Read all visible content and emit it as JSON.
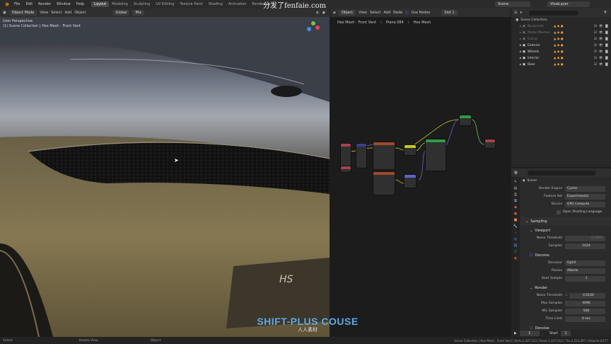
{
  "menu": [
    "File",
    "Edit",
    "Render",
    "Window",
    "Help"
  ],
  "workspaces": [
    "Layout",
    "Modeling",
    "Sculpting",
    "UV Editing",
    "Texture Paint",
    "Shading",
    "Animation",
    "Rendering"
  ],
  "active_workspace": "Layout",
  "topbar_right": {
    "watermark": "分发了fenfaie.com",
    "scene": "Scene",
    "viewlayer": "ViewLayer"
  },
  "viewport": {
    "mode": "Object Mode",
    "menus": [
      "View",
      "Select",
      "Add",
      "Object"
    ],
    "transform": "Global",
    "mix": "Mix",
    "title": "User Perspective",
    "subtitle": "(1) Scene Collection | Hex Mesh - Front Vent"
  },
  "node_editor": {
    "type": "Object",
    "menus": [
      "View",
      "Select",
      "Add",
      "Node"
    ],
    "use_nodes": "Use Nodes",
    "slot": "Slot 1",
    "breadcrumb": [
      "Hex Mesh - Front Vent",
      "Plane.084",
      "Hex Mesh"
    ]
  },
  "outliner": {
    "root": "Scene Collection",
    "items": [
      {
        "label": "Blueprints",
        "dim": true
      },
      {
        "label": "Model Meshes",
        "dim": true
      },
      {
        "label": "Extras",
        "dim": true
      },
      {
        "label": "Exterior",
        "dim": false
      },
      {
        "label": "Wheels",
        "dim": false
      },
      {
        "label": "Interior",
        "dim": false
      },
      {
        "label": "Door",
        "dim": false
      }
    ]
  },
  "properties": {
    "title": "Scene",
    "render_engine": {
      "label": "Render Engine",
      "value": "Cycles"
    },
    "feature_set": {
      "label": "Feature Set",
      "value": "Experimental"
    },
    "device": {
      "label": "Device",
      "value": "GPU Compute"
    },
    "osl": "Open Shading Language",
    "sampling": "Sampling",
    "viewport_section": "Viewport",
    "noise_threshold_vp": {
      "label": "Noise Threshold",
      "value": "0.1000"
    },
    "samples_vp": {
      "label": "Samples",
      "value": "1024"
    },
    "denoise": "Denoise",
    "denoiser": {
      "label": "Denoiser",
      "value": "OptiX"
    },
    "passes": {
      "label": "Passes",
      "value": "Albedo"
    },
    "start_sample": {
      "label": "Start Sample",
      "value": "1"
    },
    "render_section": "Render",
    "noise_threshold_r": {
      "label": "Noise Threshold",
      "value": "0.0100"
    },
    "max_samples": {
      "label": "Max Samples",
      "value": "4096"
    },
    "min_samples": {
      "label": "Min Samples",
      "value": "500"
    },
    "time_limit": {
      "label": "Time Limit",
      "value": "0 sec"
    },
    "denoise_bottom": "Denoise"
  },
  "status": {
    "select": "Select",
    "rotate": "Rotate View",
    "object": "Object",
    "info": "Scene Collection | Hex Mesh - Front Vent | Verts:1,427,123 | Faces:1,427,913 | Tris:3,224,397 | Objects:0/277"
  },
  "frame": {
    "current": "1",
    "start_label": "Start",
    "start": "1"
  },
  "overlay_brand": {
    "line1": "SHIFT-PLUS COUSE",
    "line2": "人人素材"
  },
  "colors": {
    "accent": "#4772b3",
    "bg": "#1d1d1d",
    "panel": "#2b2b2b"
  }
}
